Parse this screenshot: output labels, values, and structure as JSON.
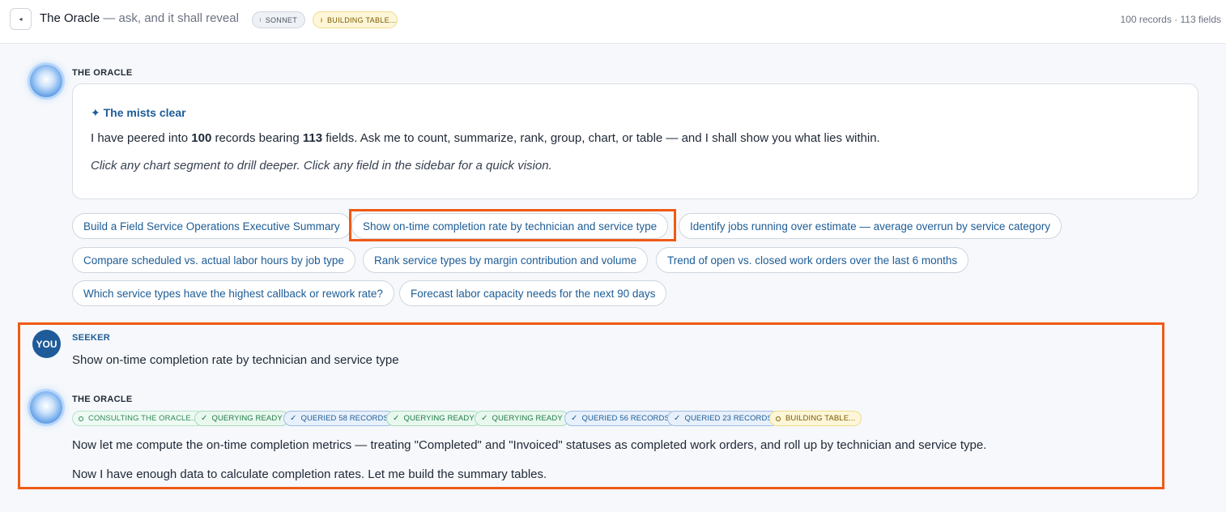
{
  "header": {
    "back_glyph": "◂",
    "title": "The Oracle",
    "subtitle": " — ask, and it shall reveal",
    "model_badge": "SONNET",
    "status_badge": "BUILDING TABLE...",
    "summary": "100 records · 113 fields"
  },
  "intro": {
    "speaker": "THE ORACLE",
    "card_title": "✦ The mists clear",
    "body_prefix": "I have peered into ",
    "records": "100",
    "body_mid": " records bearing ",
    "fields": "113",
    "body_suffix": " fields. Ask me to count, summarize, rank, group, chart, or table — and I shall show you what lies within.",
    "hint": "Click any chart segment to drill deeper. Click any field in the sidebar for a quick vision."
  },
  "suggestions": [
    "Build a Field Service Operations Executive Summary",
    "Show on-time completion rate by technician and service type",
    "Identify jobs running over estimate — average overrun by service category",
    "Compare scheduled vs. actual labor hours by job type",
    "Rank service types by margin contribution and volume",
    "Trend of open vs. closed work orders over the last 6 months",
    "Which service types have the highest callback or rework rate?",
    "Forecast labor capacity needs for the next 90 days"
  ],
  "user_message": {
    "avatar": "YOU",
    "speaker": "SEEKER",
    "text": "Show on-time completion rate by technician and service type"
  },
  "oracle_reply": {
    "speaker": "THE ORACLE",
    "tags": [
      "CONSULTING THE ORACLE...",
      "QUERYING READY",
      "QUERIED 58 RECORDS",
      "QUERYING READY",
      "QUERYING READY",
      "QUERIED 56 RECORDS",
      "QUERIED 23 RECORDS",
      "BUILDING TABLE..."
    ],
    "line1": "Now let me compute the on-time completion metrics — treating \"Completed\" and \"Invoiced\" statuses as completed work orders, and roll up by technician and service type.",
    "line2": "Now I have enough data to calculate completion rates. Let me build the summary tables."
  },
  "colors": {
    "accent": "#1d5c96",
    "highlight": "#f05a15"
  }
}
